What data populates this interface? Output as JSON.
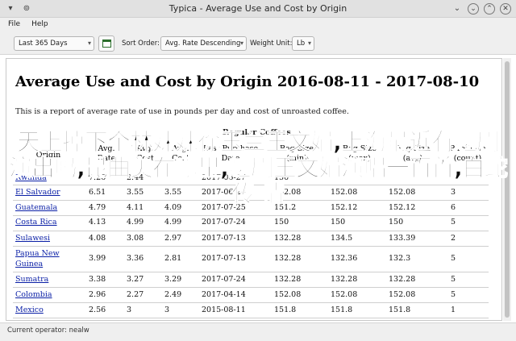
{
  "window": {
    "title": "Typica - Average Use and Cost by Origin"
  },
  "menu": [
    "File",
    "Help"
  ],
  "toolbar": {
    "date_range": "Last 365 Days",
    "sort_label": "Sort Order:",
    "sort_value": "Avg. Rate Descending",
    "unit_label": "Weight Unit:",
    "unit_value": "Lb"
  },
  "report": {
    "title": "Average Use and Cost by Origin 2016-08-11 - 2017-08-10",
    "description": "This is a report of average rate of use in pounds per day and cost of unroasted coffee.",
    "caption": "Regular Coffees",
    "columns": [
      "Origin",
      "Avg. Rate",
      "Avg. Cost",
      "Avg. Cost",
      "Last Purchase Date",
      "Bag Size (min)",
      "Bag Size (max)",
      "Bag Size (avg)",
      "Purchase (count)"
    ],
    "rows": [
      [
        "Rwanda",
        "7.26",
        "2.44",
        "",
        "2017-06-27",
        "150",
        "",
        "",
        ""
      ],
      [
        "El Salvador",
        "6.51",
        "3.55",
        "3.55",
        "2017-06-28",
        "152.08",
        "152.08",
        "152.08",
        "3"
      ],
      [
        "Guatemala",
        "4.79",
        "4.11",
        "4.09",
        "2017-07-25",
        "151.2",
        "152.12",
        "152.12",
        "6"
      ],
      [
        "Costa Rica",
        "4.13",
        "4.99",
        "4.99",
        "2017-07-24",
        "150",
        "150",
        "150",
        "5"
      ],
      [
        "Sulawesi",
        "4.08",
        "3.08",
        "2.97",
        "2017-07-13",
        "132.28",
        "134.5",
        "133.39",
        "2"
      ],
      [
        "Papua New Guinea",
        "3.99",
        "3.36",
        "2.81",
        "2017-07-13",
        "132.28",
        "132.36",
        "132.3",
        "5"
      ],
      [
        "Sumatra",
        "3.38",
        "3.27",
        "3.29",
        "2017-07-24",
        "132.28",
        "132.28",
        "132.28",
        "5"
      ],
      [
        "Colombia",
        "2.96",
        "2.27",
        "2.49",
        "2017-04-14",
        "152.08",
        "152.08",
        "152.08",
        "5"
      ],
      [
        "Mexico",
        "2.56",
        "3",
        "3",
        "2015-08-11",
        "151.8",
        "151.8",
        "151.8",
        "1"
      ]
    ]
  },
  "overlay_text": "天上掉下个林妹妹徐玉兰王文娟,上海最近有越剧演出吗,昆曲美在哪里,越剧王文娟演唱一百首,白蛇传 情",
  "status": "Current operator: nealw"
}
